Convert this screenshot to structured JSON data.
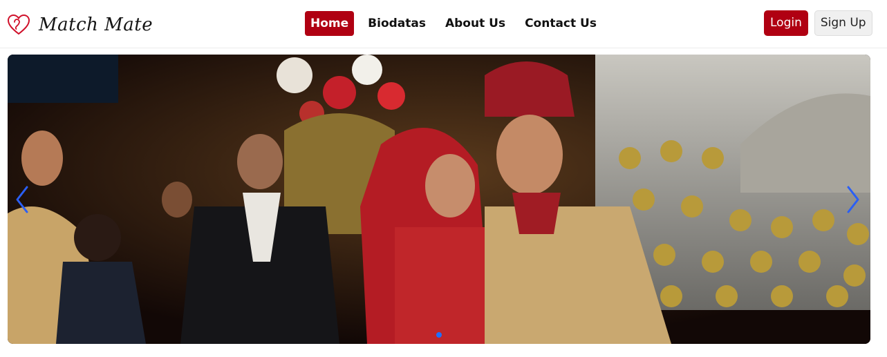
{
  "brand": {
    "name": "Match Mate",
    "icon": "heart-logo-icon",
    "color": "#d0102a"
  },
  "nav": {
    "links": [
      {
        "label": "Home",
        "active": true
      },
      {
        "label": "Biodatas",
        "active": false
      },
      {
        "label": "About Us",
        "active": false
      },
      {
        "label": "Contact Us",
        "active": false
      }
    ]
  },
  "auth": {
    "login_label": "Login",
    "signup_label": "Sign Up"
  },
  "carousel": {
    "prev_icon": "chevron-left-icon",
    "next_icon": "chevron-right-icon",
    "slide_count": 1,
    "active_slide": 1
  },
  "colors": {
    "accent": "#b00012",
    "indicator_active": "#1e6fff"
  }
}
